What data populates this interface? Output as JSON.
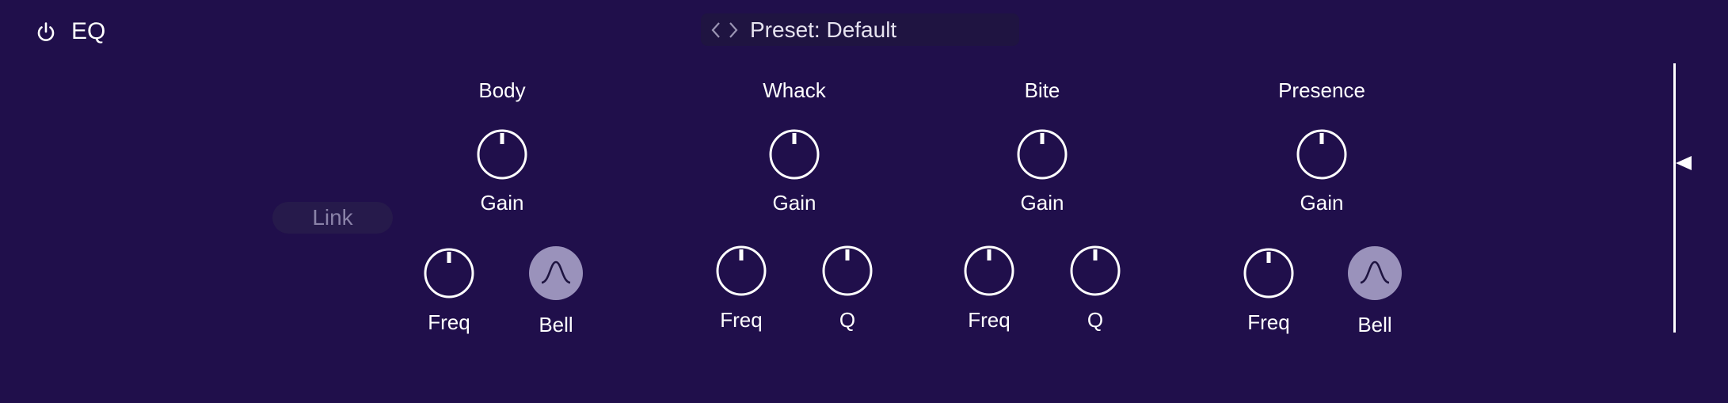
{
  "header": {
    "title": "EQ",
    "power_icon": "power-icon",
    "preset": {
      "label": "Preset: Default",
      "prev_icon": "chevron-left-icon",
      "next_icon": "chevron-right-icon"
    }
  },
  "link": {
    "label": "Link"
  },
  "bands": [
    {
      "name": "Body",
      "gain_label": "Gain",
      "freq_label": "Freq",
      "shape_label": "Bell",
      "shape_icon": "bell-curve-icon"
    },
    {
      "name": "Whack",
      "gain_label": "Gain",
      "freq_label": "Freq",
      "q_label": "Q"
    },
    {
      "name": "Bite",
      "gain_label": "Gain",
      "freq_label": "Freq",
      "q_label": "Q"
    },
    {
      "name": "Presence",
      "gain_label": "Gain",
      "freq_label": "Freq",
      "shape_label": "Bell",
      "shape_icon": "bell-curve-icon"
    }
  ],
  "colors": {
    "background": "#200f4b",
    "preset_bar": "#1f1441",
    "link_bg": "#261a4b",
    "link_text": "#8a82a8",
    "shape_button": "#9a92bb",
    "foreground": "#ffffff"
  }
}
